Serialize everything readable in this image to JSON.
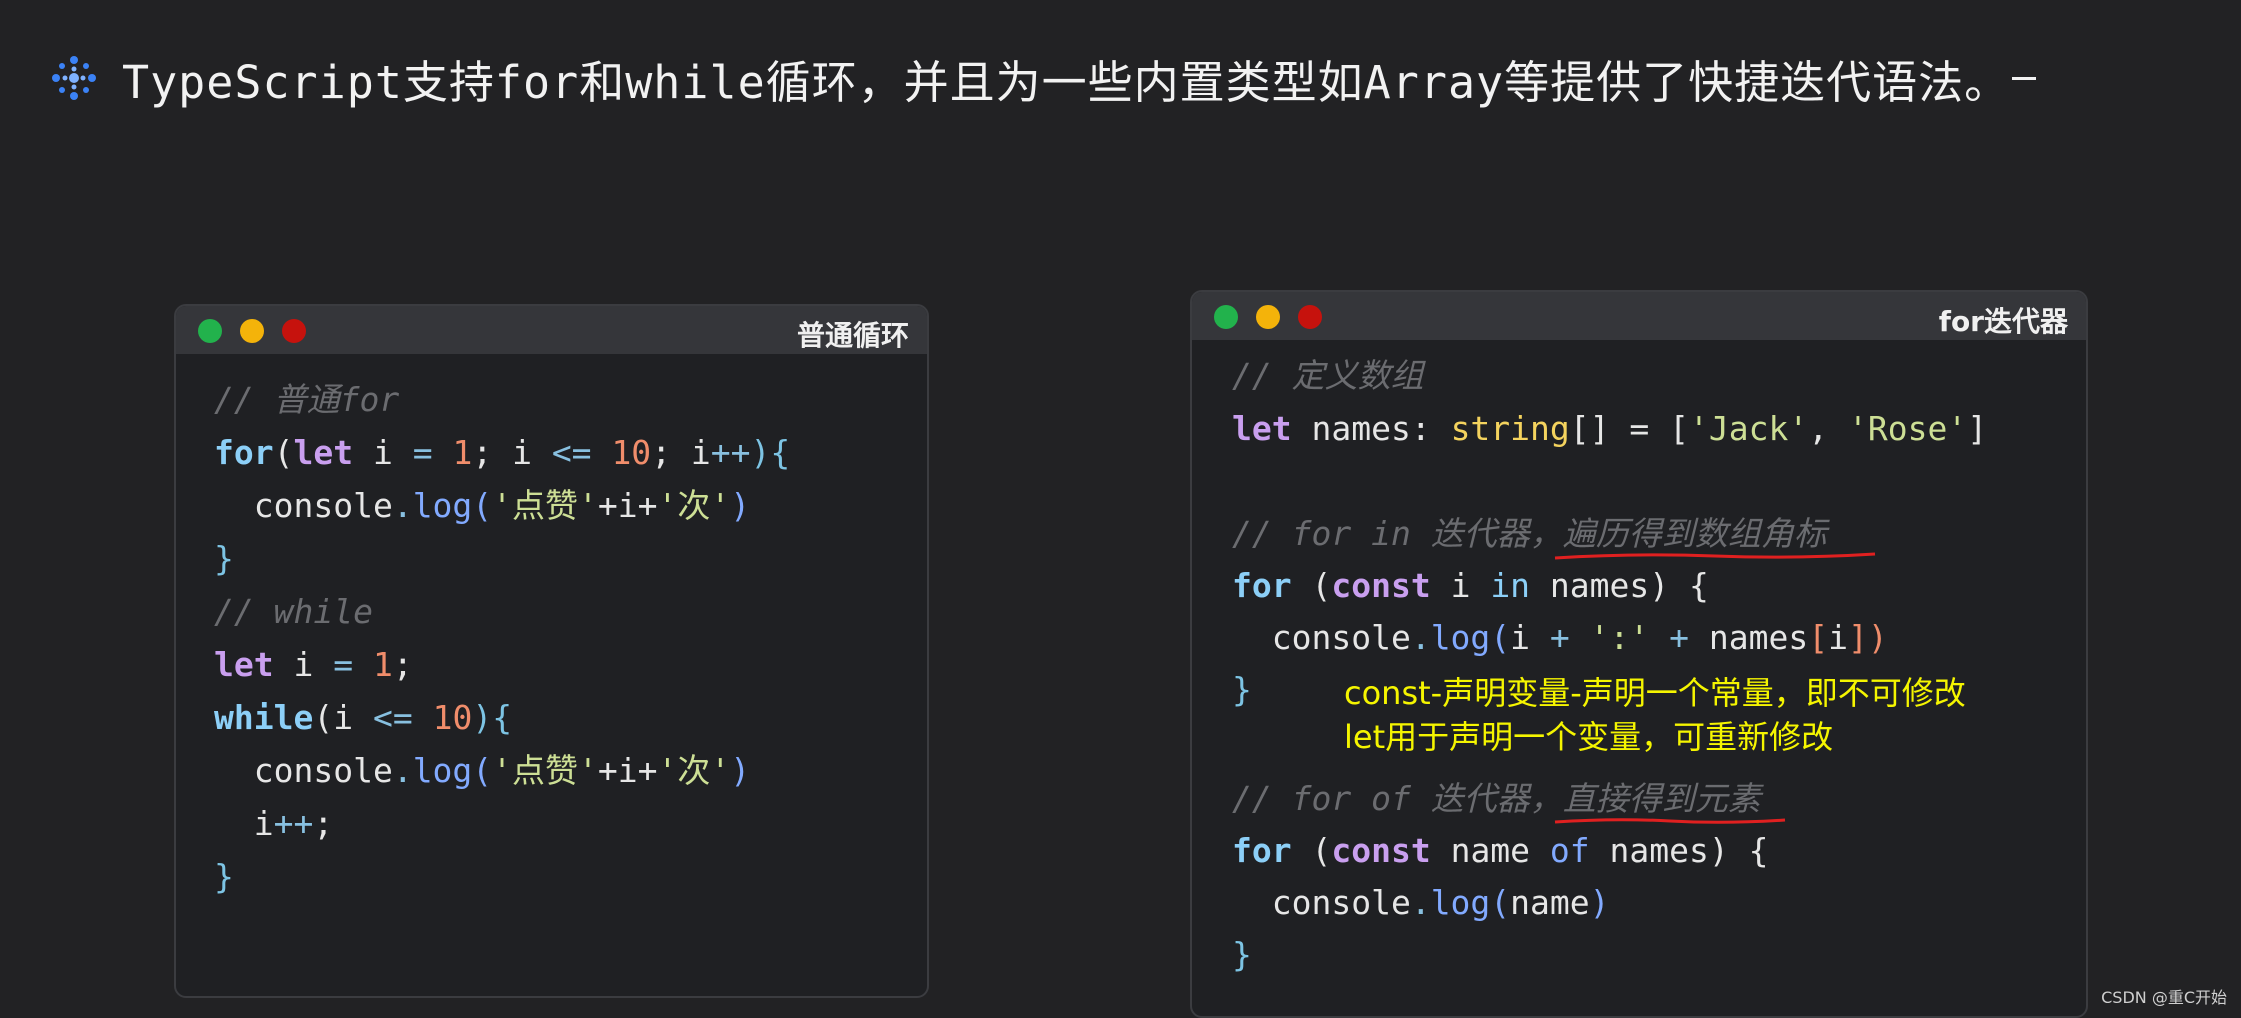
{
  "heading": {
    "text": "TypeScript支持for和while循环，并且为一些内置类型如Array等提供了快捷迭代语法。"
  },
  "left_window": {
    "title": "普通循环",
    "lines": {
      "l1_comment": "// 普通for",
      "l2_for": "for",
      "l2_paren": "(",
      "l2_let": "let",
      "l2_a": " i ",
      "l2_eq": "=",
      "l2_b": " ",
      "l2_one": "1",
      "l2_c": "; i ",
      "l2_le": "<=",
      "l2_d": " ",
      "l2_ten": "10",
      "l2_e": "; i",
      "l2_pp": "++",
      "l2_f": "){",
      "l3_console": "  console",
      "l3_dot": ".",
      "l3_log": "log",
      "l3_p1": "(",
      "l3_s1": "'点赞'",
      "l3_plus1": "+i+",
      "l3_s2": "'次'",
      "l3_p2": ")",
      "l4_close": "}",
      "l5_comment": "// while",
      "l6_let": "let",
      "l6_a": " i ",
      "l6_eq": "=",
      "l6_b": " ",
      "l6_one": "1",
      "l6_c": ";",
      "l7_while": "while",
      "l7_a": "(i ",
      "l7_le": "<=",
      "l7_b": " ",
      "l7_ten": "10",
      "l7_c": "){",
      "l8_console": "  console",
      "l8_dot": ".",
      "l8_log": "log",
      "l8_p1": "(",
      "l8_s1": "'点赞'",
      "l8_plus1": "+i+",
      "l8_s2": "'次'",
      "l8_p2": ")",
      "l9_i": "  i",
      "l9_pp": "++",
      "l9_semi": ";",
      "l10_close": "}"
    }
  },
  "right_window": {
    "title": "for迭代器",
    "lines": {
      "r1_comment": "// 定义数组",
      "r2_let": "let",
      "r2_a": " names: ",
      "r2_type": "string",
      "r2_b": "[] = [",
      "r2_s1": "'Jack'",
      "r2_c": ", ",
      "r2_s2": "'Rose'",
      "r2_d": "]",
      "r3_comment_a": "// for in 迭代器，",
      "r3_comment_b": "遍历得到数组角标",
      "r4_for": "for",
      "r4_a": " (",
      "r4_const": "const",
      "r4_b": " i ",
      "r4_in": "in",
      "r4_c": " names) {",
      "r5_console": "  console",
      "r5_dot": ".",
      "r5_log": "log",
      "r5_p1": "(",
      "r5_a": "i ",
      "r5_plus": "+",
      "r5_b": " ",
      "r5_str": "':'",
      "r5_c": " ",
      "r5_plus2": "+",
      "r5_d": " names",
      "r5_br": "[",
      "r5_e": "i",
      "r5_br2": "])",
      "r6_close": "}",
      "r7_comment_a": "// for of 迭代器，",
      "r7_comment_b": "直接得到元素",
      "r8_for": "for",
      "r8_a": " (",
      "r8_const": "const",
      "r8_b": " name ",
      "r8_of": "of",
      "r8_c": " names) {",
      "r9_console": "  console",
      "r9_dot": ".",
      "r9_log": "log",
      "r9_p1": "(",
      "r9_a": "name",
      "r9_p2": ")",
      "r10_close": "}"
    },
    "notes": {
      "note1": "const-声明变量-声明一个常量，即不可修改",
      "note2": "let用于声明一个变量，可重新修改"
    }
  },
  "watermark": "CSDN @重C开始",
  "colors": {
    "annotation": "#f5f500",
    "underline": "#e02020",
    "dot_green": "#22b24c",
    "dot_yellow": "#f4b30a",
    "dot_red": "#c6120d"
  }
}
